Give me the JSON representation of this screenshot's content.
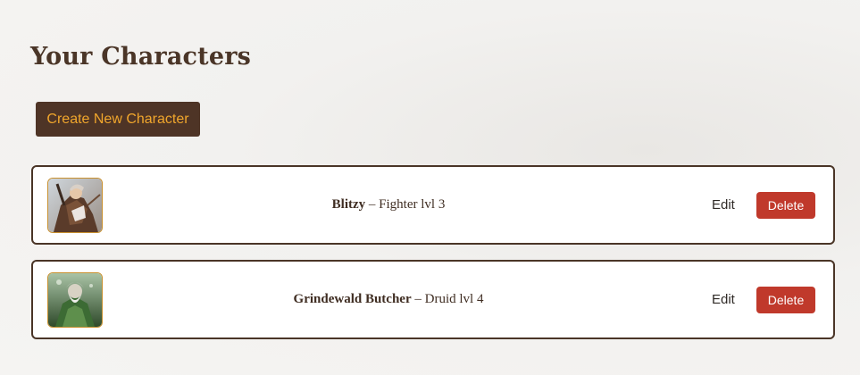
{
  "page": {
    "title": "Your Characters",
    "create_button_label": "Create New Character"
  },
  "characters": [
    {
      "name": "Blitzy",
      "separator": "–",
      "class_level": "Fighter lvl 3",
      "edit_label": "Edit",
      "delete_label": "Delete",
      "avatar_icon": "fighter-portrait-icon"
    },
    {
      "name": "Grindewald Butcher",
      "separator": "–",
      "class_level": "Druid lvl 4",
      "edit_label": "Edit",
      "delete_label": "Delete",
      "avatar_icon": "druid-portrait-icon"
    }
  ],
  "colors": {
    "accent_brown": "#4e3426",
    "accent_gold": "#f0a62c",
    "delete_red": "#c0392b"
  }
}
